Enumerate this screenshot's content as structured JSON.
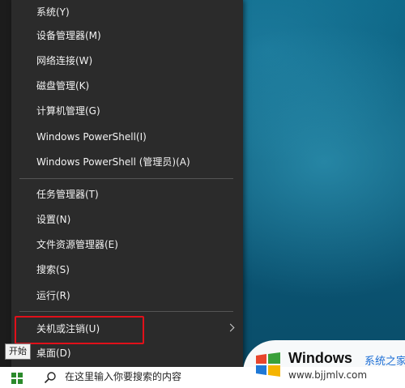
{
  "context_menu": {
    "items": [
      {
        "label": "系统(Y)"
      },
      {
        "label": "设备管理器(M)"
      },
      {
        "label": "网络连接(W)"
      },
      {
        "label": "磁盘管理(K)"
      },
      {
        "label": "计算机管理(G)"
      },
      {
        "label": "Windows PowerShell(I)"
      },
      {
        "label": "Windows PowerShell (管理员)(A)"
      },
      {
        "label": "任务管理器(T)"
      },
      {
        "label": "设置(N)"
      },
      {
        "label": "文件资源管理器(E)"
      },
      {
        "label": "搜索(S)"
      },
      {
        "label": "运行(R)"
      },
      {
        "label": "关机或注销(U)"
      },
      {
        "label": "桌面(D)"
      }
    ]
  },
  "tooltip": {
    "text": "开始"
  },
  "taskbar": {
    "search_placeholder": "在这里输入你要搜索的内容"
  },
  "watermark": {
    "name": "Windows",
    "cn": "系统之家",
    "url": "www.bjjmlv.com"
  },
  "colors": {
    "highlight_border": "#e1101a",
    "menu_bg": "#2b2b2b"
  }
}
